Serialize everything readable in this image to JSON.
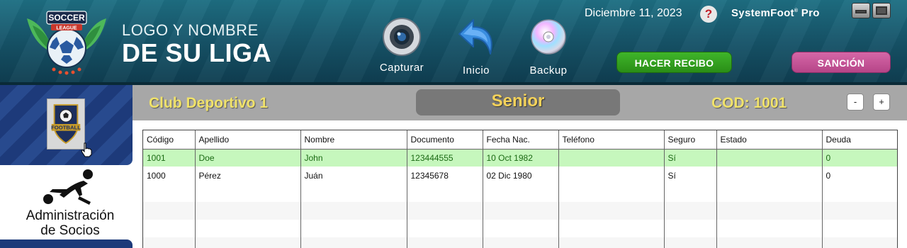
{
  "header": {
    "league_logo": {
      "line1": "SOCCER",
      "line2": "LEAGUE"
    },
    "league_name_line1": "LOGO Y NOMBRE",
    "league_name_line2": "DE SU LIGA",
    "tools": [
      {
        "label": "Capturar",
        "icon": "camera-icon"
      },
      {
        "label": "Inicio",
        "icon": "back-arrow-icon"
      },
      {
        "label": "Backup",
        "icon": "disc-icon"
      }
    ],
    "date": "Diciembre 11, 2023",
    "help": "?",
    "brand": "SystemFoot",
    "brand_mark": "®",
    "brand_suffix": "Pro",
    "receipt_button": "HACER RECIBO",
    "sanction_button": "SANCIÓN"
  },
  "sidebar": {
    "team_badge_text": "FOOTBALL",
    "admin_label_line1": "Administración",
    "admin_label_line2": "de Socios"
  },
  "main": {
    "club": "Club Deportivo 1",
    "category": "Senior",
    "cod": "COD: 1001",
    "minus": "-",
    "plus": "+"
  },
  "table": {
    "columns": [
      "Código",
      "Apellido",
      "Nombre",
      "Documento",
      "Fecha Nac.",
      "Teléfono",
      "Seguro",
      "Estado",
      "Deuda"
    ],
    "rows": [
      [
        "1001",
        "Doe",
        "John",
        "123444555",
        "10 Oct 1982",
        "",
        "Sí",
        "",
        "0"
      ],
      [
        "1000",
        "Pérez",
        "Juán",
        "12345678",
        "02 Dic 1980",
        "",
        "Sí",
        "",
        "0"
      ]
    ],
    "selected_row": 0
  },
  "colors": {
    "header": "#17566b",
    "accent_yellow": "#f0e26a",
    "green_button": "#3fb52a",
    "pink_button": "#c9559a",
    "selected_row": "#c6f7bd"
  }
}
